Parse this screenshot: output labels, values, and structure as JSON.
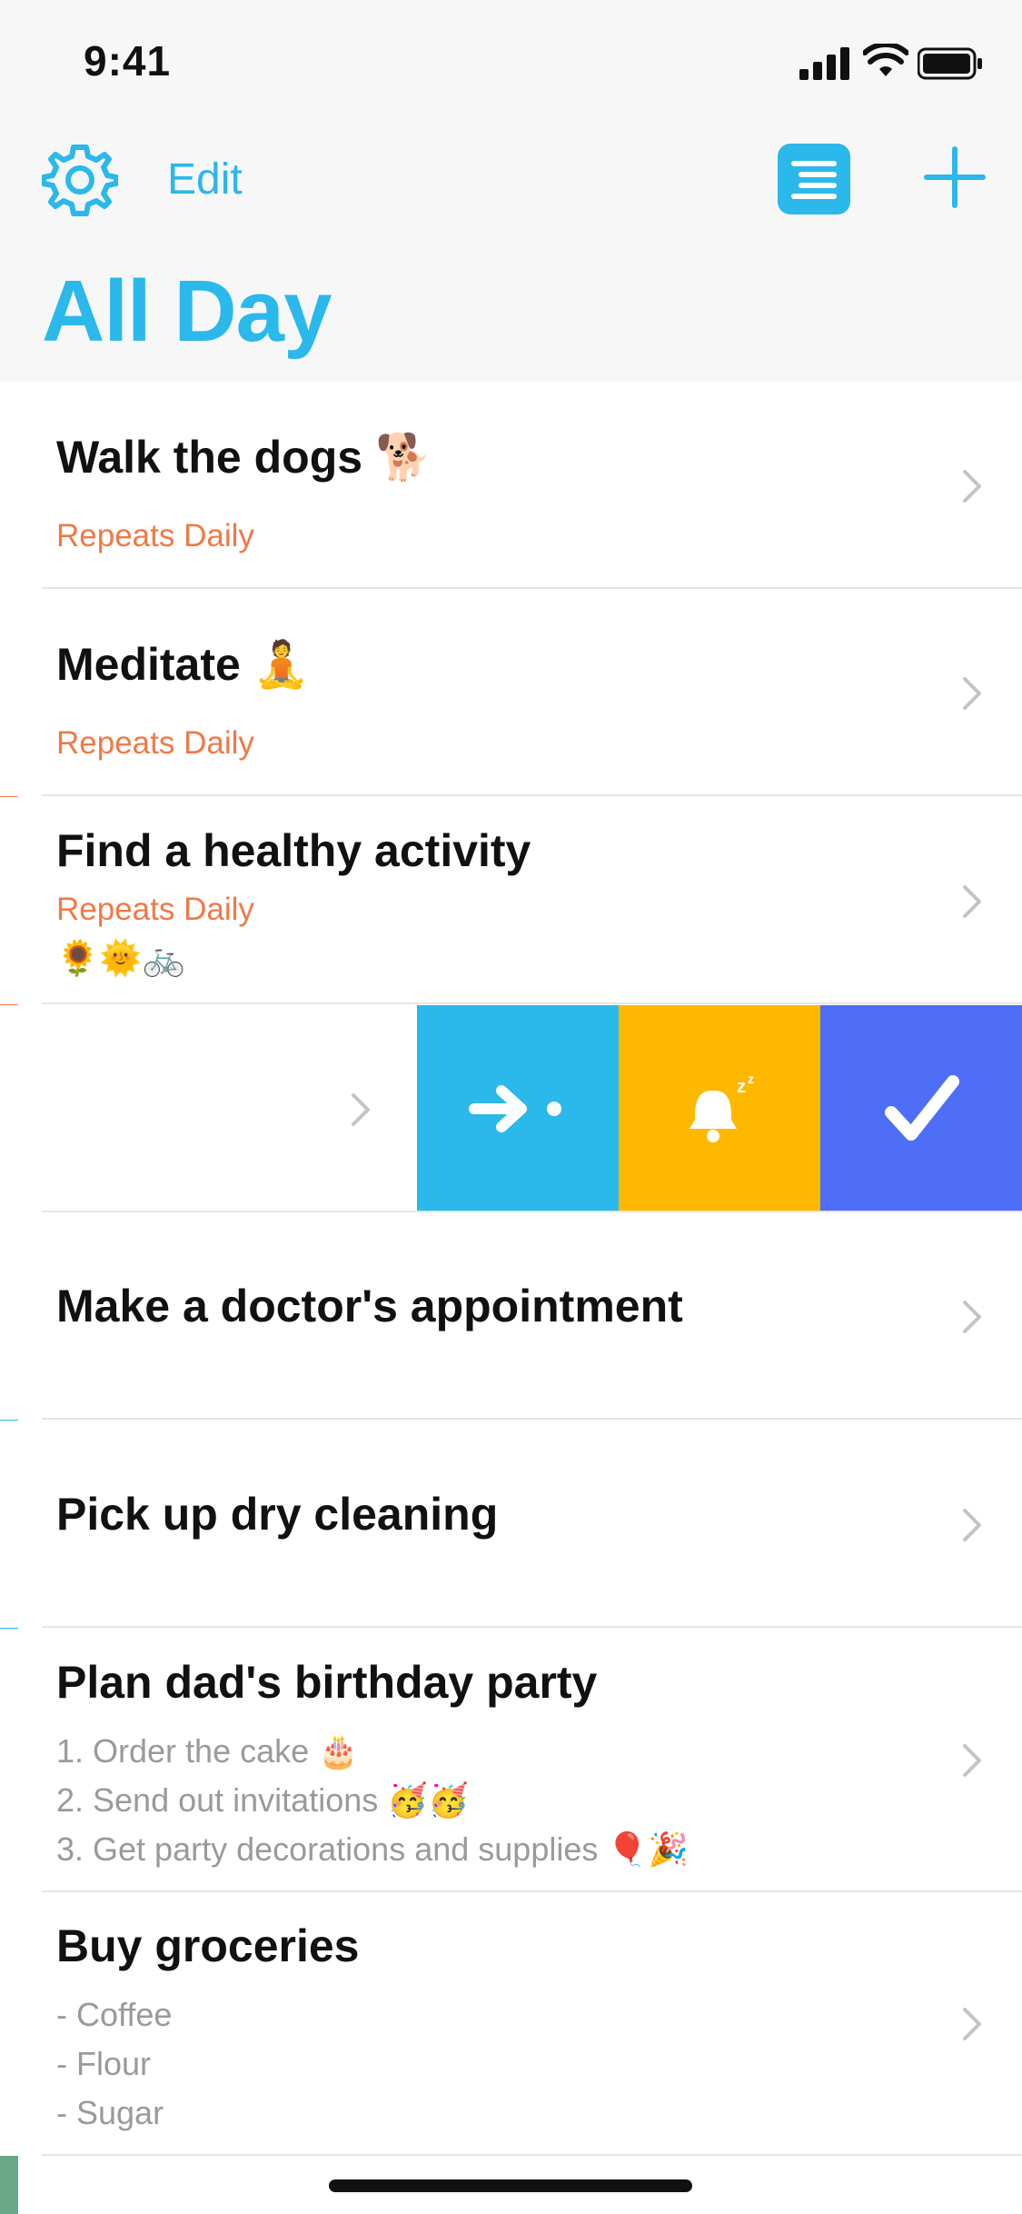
{
  "status_bar": {
    "time": "9:41"
  },
  "header": {
    "edit_label": "Edit",
    "title": "All Day",
    "accent": "#2bb8ea"
  },
  "tasks": [
    {
      "title": "Walk the dogs 🐕",
      "subtitle": "Repeats Daily"
    },
    {
      "title": "Meditate 🧘",
      "subtitle": "Repeats Daily"
    },
    {
      "title": "Find a healthy activity",
      "subtitle": "Repeats Daily",
      "emojis": "🌻🌞🚲"
    },
    {
      "title": "Make a doctor's appointment"
    },
    {
      "title": "Pick up dry cleaning"
    },
    {
      "title": "Plan dad's birthday party",
      "notes": [
        "1. Order the cake 🎂",
        "2. Send out invitations 🥳🥳",
        "3. Get party decorations and supplies 🎈🎉"
      ]
    },
    {
      "title": "Buy groceries",
      "notes": [
        "- Coffee",
        "- Flour",
        "- Sugar"
      ]
    }
  ],
  "swipe_actions": [
    {
      "name": "move",
      "color": "#2bb8ea"
    },
    {
      "name": "snooze",
      "color": "#ffb800"
    },
    {
      "name": "complete",
      "color": "#4e6ef8"
    }
  ],
  "bars": {
    "orange": "#f47b4a",
    "blue": "#2bb8ea",
    "green": "#6aa88a"
  }
}
